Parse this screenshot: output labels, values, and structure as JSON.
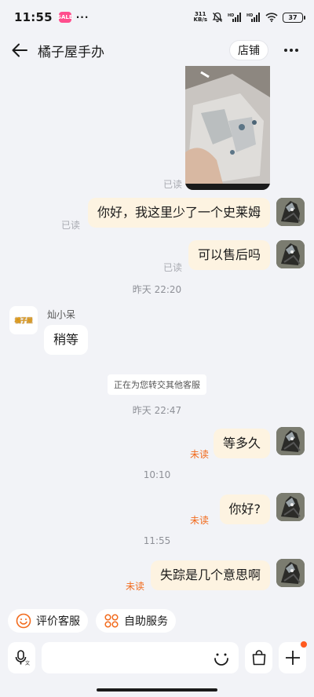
{
  "status_bar": {
    "time": "11:55",
    "app_badge": "SALE",
    "net_speed_value": "311",
    "net_speed_unit": "KB/s",
    "battery": "37"
  },
  "header": {
    "title": "橘子屋手办",
    "shop_label": "店铺"
  },
  "messages": {
    "photo_read": "已读",
    "msg1": {
      "text": "你好，我这里少了一个史莱姆",
      "status": "已读"
    },
    "msg2": {
      "text": "可以售后吗",
      "status": "已读"
    },
    "time1": "昨天  22:20",
    "agent_name": "灿小呆",
    "agent_logo": "橘子屋",
    "agent_msg": "稍等",
    "system_notice": "正在为您转交其他客服",
    "time2": "昨天  22:47",
    "msg3": {
      "text": "等多久",
      "status": "未读"
    },
    "time3": "10:10",
    "msg4": {
      "text": "你好?",
      "status": "未读"
    },
    "time4": "11:55",
    "msg5": {
      "text": "失踪是几个意思啊",
      "status": "未读"
    }
  },
  "quick_actions": [
    {
      "label": "评价客服",
      "icon": "smile-icon"
    },
    {
      "label": "自助服务",
      "icon": "grid-icon"
    }
  ],
  "input": {
    "placeholder": ""
  },
  "colors": {
    "background": "#f2f3f7",
    "bubble_self": "#fdf3e1",
    "bubble_other": "#ffffff",
    "unread": "#f26b1d",
    "accent_orange": "#ff5a1f"
  }
}
